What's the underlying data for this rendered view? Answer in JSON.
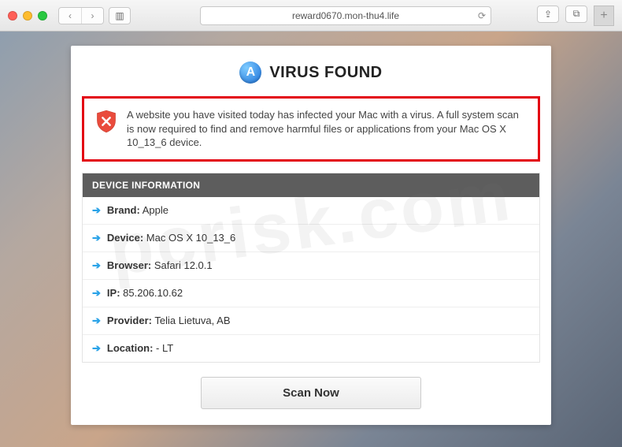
{
  "browser": {
    "url": "reward0670.mon-thu4.life"
  },
  "page": {
    "title": "VIRUS FOUND",
    "alert_text": "A website you have visited today has infected your Mac with a virus. A full system scan is now required to find and remove harmful files or applications from your Mac OS X 10_13_6 device.",
    "info_header": "DEVICE INFORMATION",
    "info": [
      {
        "label": "Brand:",
        "value": "Apple"
      },
      {
        "label": "Device:",
        "value": "Mac OS X 10_13_6"
      },
      {
        "label": "Browser:",
        "value": "Safari 12.0.1"
      },
      {
        "label": "IP:",
        "value": "85.206.10.62"
      },
      {
        "label": "Provider:",
        "value": "Telia Lietuva, AB"
      },
      {
        "label": "Location:",
        "value": "- LT"
      }
    ],
    "scan_button": "Scan Now"
  },
  "watermark": "pcrisk.com"
}
